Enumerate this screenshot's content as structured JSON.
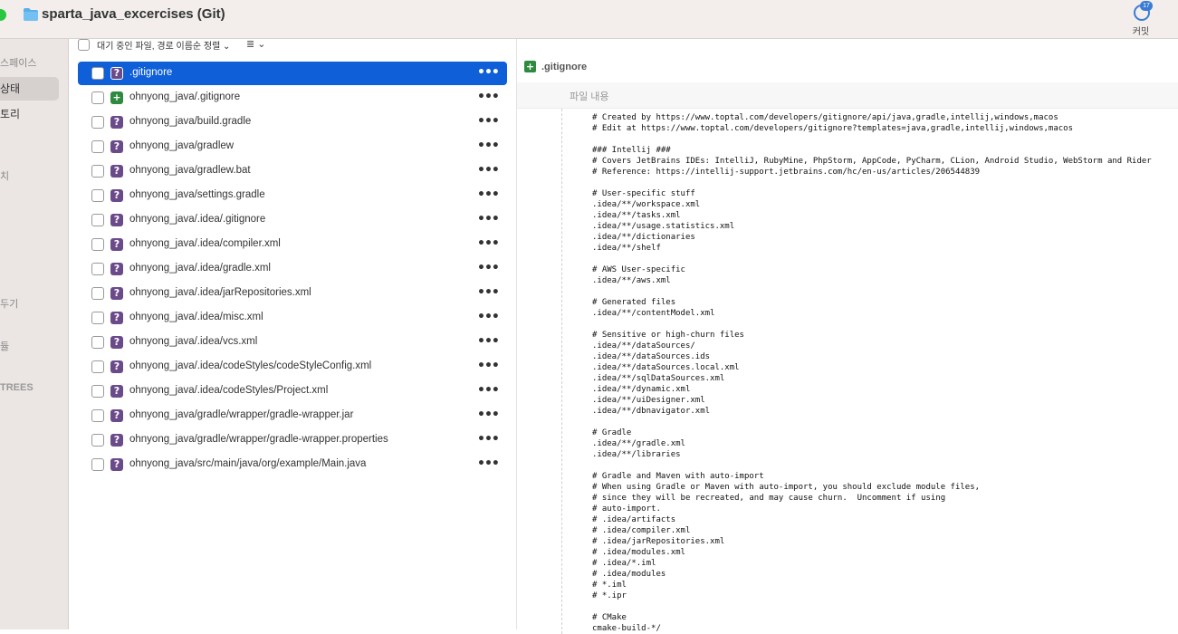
{
  "window": {
    "title": "sparta_java_excercises (Git)"
  },
  "toolbar": {
    "commit_label": "커밋",
    "commit_badge": "17"
  },
  "sidebar": {
    "section_workspace": "스페이스",
    "item_status": "상태",
    "item_history": "토리",
    "section_branches": "치",
    "section_stashes": "두기",
    "section_submodules": "듈",
    "section_subtrees": "TREES"
  },
  "filelist": {
    "sort_label": "대기 중인 파일, 경로 이름순 정렬 ⌄",
    "view_icon": "≣ ⌄",
    "files": [
      {
        "name": ".gitignore",
        "status": "?"
      },
      {
        "name": "ohnyong_java/.gitignore",
        "status": "+"
      },
      {
        "name": "ohnyong_java/build.gradle",
        "status": "?"
      },
      {
        "name": "ohnyong_java/gradlew",
        "status": "?"
      },
      {
        "name": "ohnyong_java/gradlew.bat",
        "status": "?"
      },
      {
        "name": "ohnyong_java/settings.gradle",
        "status": "?"
      },
      {
        "name": "ohnyong_java/.idea/.gitignore",
        "status": "?"
      },
      {
        "name": "ohnyong_java/.idea/compiler.xml",
        "status": "?"
      },
      {
        "name": "ohnyong_java/.idea/gradle.xml",
        "status": "?"
      },
      {
        "name": "ohnyong_java/.idea/jarRepositories.xml",
        "status": "?"
      },
      {
        "name": "ohnyong_java/.idea/misc.xml",
        "status": "?"
      },
      {
        "name": "ohnyong_java/.idea/vcs.xml",
        "status": "?"
      },
      {
        "name": "ohnyong_java/.idea/codeStyles/codeStyleConfig.xml",
        "status": "?"
      },
      {
        "name": "ohnyong_java/.idea/codeStyles/Project.xml",
        "status": "?"
      },
      {
        "name": "ohnyong_java/gradle/wrapper/gradle-wrapper.jar",
        "status": "?"
      },
      {
        "name": "ohnyong_java/gradle/wrapper/gradle-wrapper.properties",
        "status": "?"
      },
      {
        "name": "ohnyong_java/src/main/java/org/example/Main.java",
        "status": "?"
      }
    ],
    "more_label": "•••"
  },
  "diff": {
    "filename": ".gitignore",
    "add_icon": "+",
    "hunk_label": "파일 내용",
    "lines": [
      "# Created by https://www.toptal.com/developers/gitignore/api/java,gradle,intellij,windows,macos",
      "# Edit at https://www.toptal.com/developers/gitignore?templates=java,gradle,intellij,windows,macos",
      "",
      "### Intellij ###",
      "# Covers JetBrains IDEs: IntelliJ, RubyMine, PhpStorm, AppCode, PyCharm, CLion, Android Studio, WebStorm and Rider",
      "# Reference: https://intellij-support.jetbrains.com/hc/en-us/articles/206544839",
      "",
      "# User-specific stuff",
      ".idea/**/workspace.xml",
      ".idea/**/tasks.xml",
      ".idea/**/usage.statistics.xml",
      ".idea/**/dictionaries",
      ".idea/**/shelf",
      "",
      "# AWS User-specific",
      ".idea/**/aws.xml",
      "",
      "# Generated files",
      ".idea/**/contentModel.xml",
      "",
      "# Sensitive or high-churn files",
      ".idea/**/dataSources/",
      ".idea/**/dataSources.ids",
      ".idea/**/dataSources.local.xml",
      ".idea/**/sqlDataSources.xml",
      ".idea/**/dynamic.xml",
      ".idea/**/uiDesigner.xml",
      ".idea/**/dbnavigator.xml",
      "",
      "# Gradle",
      ".idea/**/gradle.xml",
      ".idea/**/libraries",
      "",
      "# Gradle and Maven with auto-import",
      "# When using Gradle or Maven with auto-import, you should exclude module files,",
      "# since they will be recreated, and may cause churn.  Uncomment if using",
      "# auto-import.",
      "# .idea/artifacts",
      "# .idea/compiler.xml",
      "# .idea/jarRepositories.xml",
      "# .idea/modules.xml",
      "# .idea/*.iml",
      "# .idea/modules",
      "# *.iml",
      "# *.ipr",
      "",
      "# CMake",
      "cmake-build-*/"
    ]
  }
}
